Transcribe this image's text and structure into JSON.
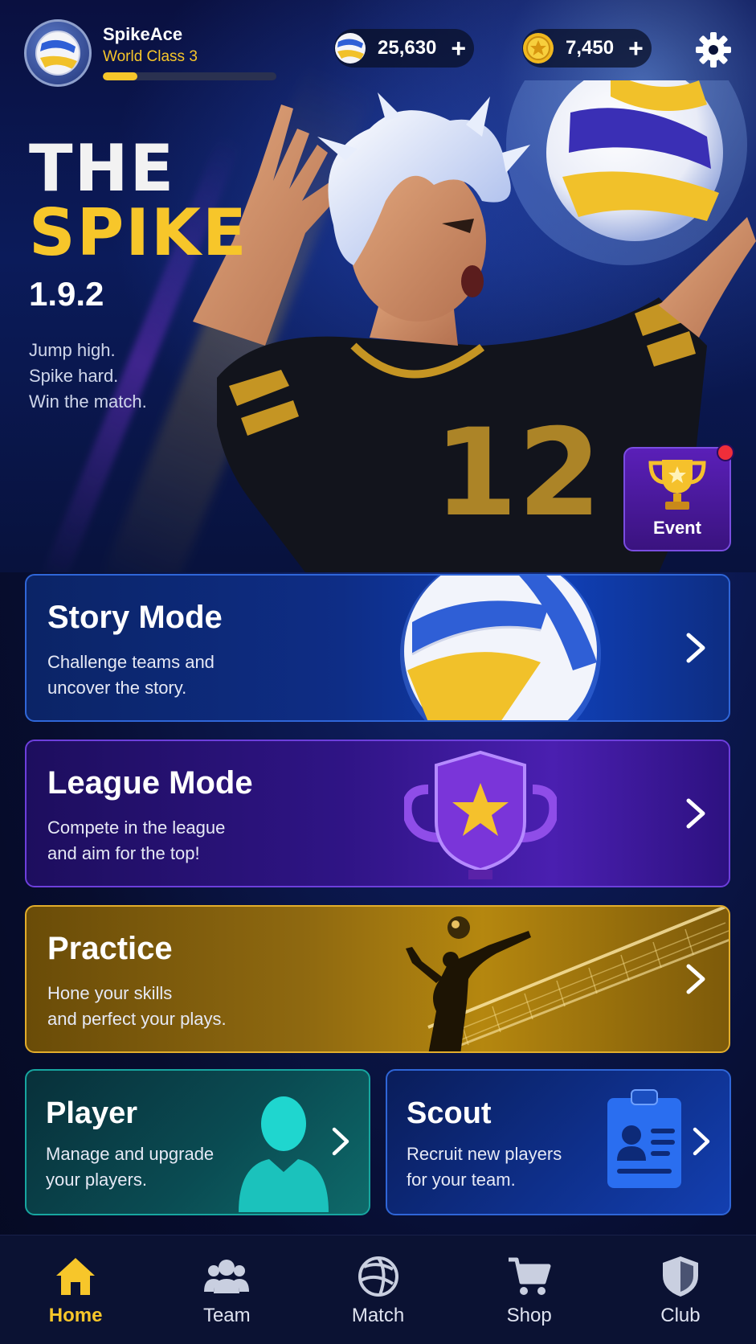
{
  "header": {
    "username": "SpikeAce",
    "rank": "World Class 3",
    "xp_progress": 0.2,
    "volleyballs": {
      "value": "25,630",
      "plus": "+",
      "icon": "volleyball-icon"
    },
    "coins": {
      "value": "7,450",
      "plus": "+",
      "icon": "coin-icon"
    },
    "settings_icon": "gear-icon"
  },
  "hero": {
    "title_line1": "THE",
    "title_line2": "SPIKE",
    "version": "1.9.2",
    "tagline": [
      "Jump high.",
      "Spike hard.",
      "Win the match."
    ],
    "event_label": "Event",
    "event_icon": "trophy-icon"
  },
  "modes": {
    "story": {
      "title": "Story Mode",
      "desc_line1": "Challenge teams and",
      "desc_line2": "uncover the story."
    },
    "league": {
      "title": "League Mode",
      "desc_line1": "Compete in the league",
      "desc_line2": "and aim for the top!"
    },
    "practice": {
      "title": "Practice",
      "desc_line1": "Hone your skills",
      "desc_line2": "and perfect your plays."
    },
    "player": {
      "title": "Player",
      "desc_line1": "Manage and upgrade",
      "desc_line2": "your players."
    },
    "scout": {
      "title": "Scout",
      "desc_line1": "Recruit new players",
      "desc_line2": "for your team."
    }
  },
  "nav": {
    "items": [
      {
        "label": "Home",
        "icon": "home-icon",
        "active": true
      },
      {
        "label": "Team",
        "icon": "team-icon",
        "active": false
      },
      {
        "label": "Match",
        "icon": "volleyball-icon",
        "active": false
      },
      {
        "label": "Shop",
        "icon": "cart-icon",
        "active": false
      },
      {
        "label": "Club",
        "icon": "shield-icon",
        "active": false
      }
    ]
  },
  "colors": {
    "accent_gold": "#f7c62a",
    "background_navy": "#060b24",
    "story_blue": "#1040b8",
    "league_purple": "#4a1fb0",
    "practice_gold": "#b5870f",
    "player_teal": "#0e6a6a",
    "event_red_dot": "#ef2e3a"
  }
}
